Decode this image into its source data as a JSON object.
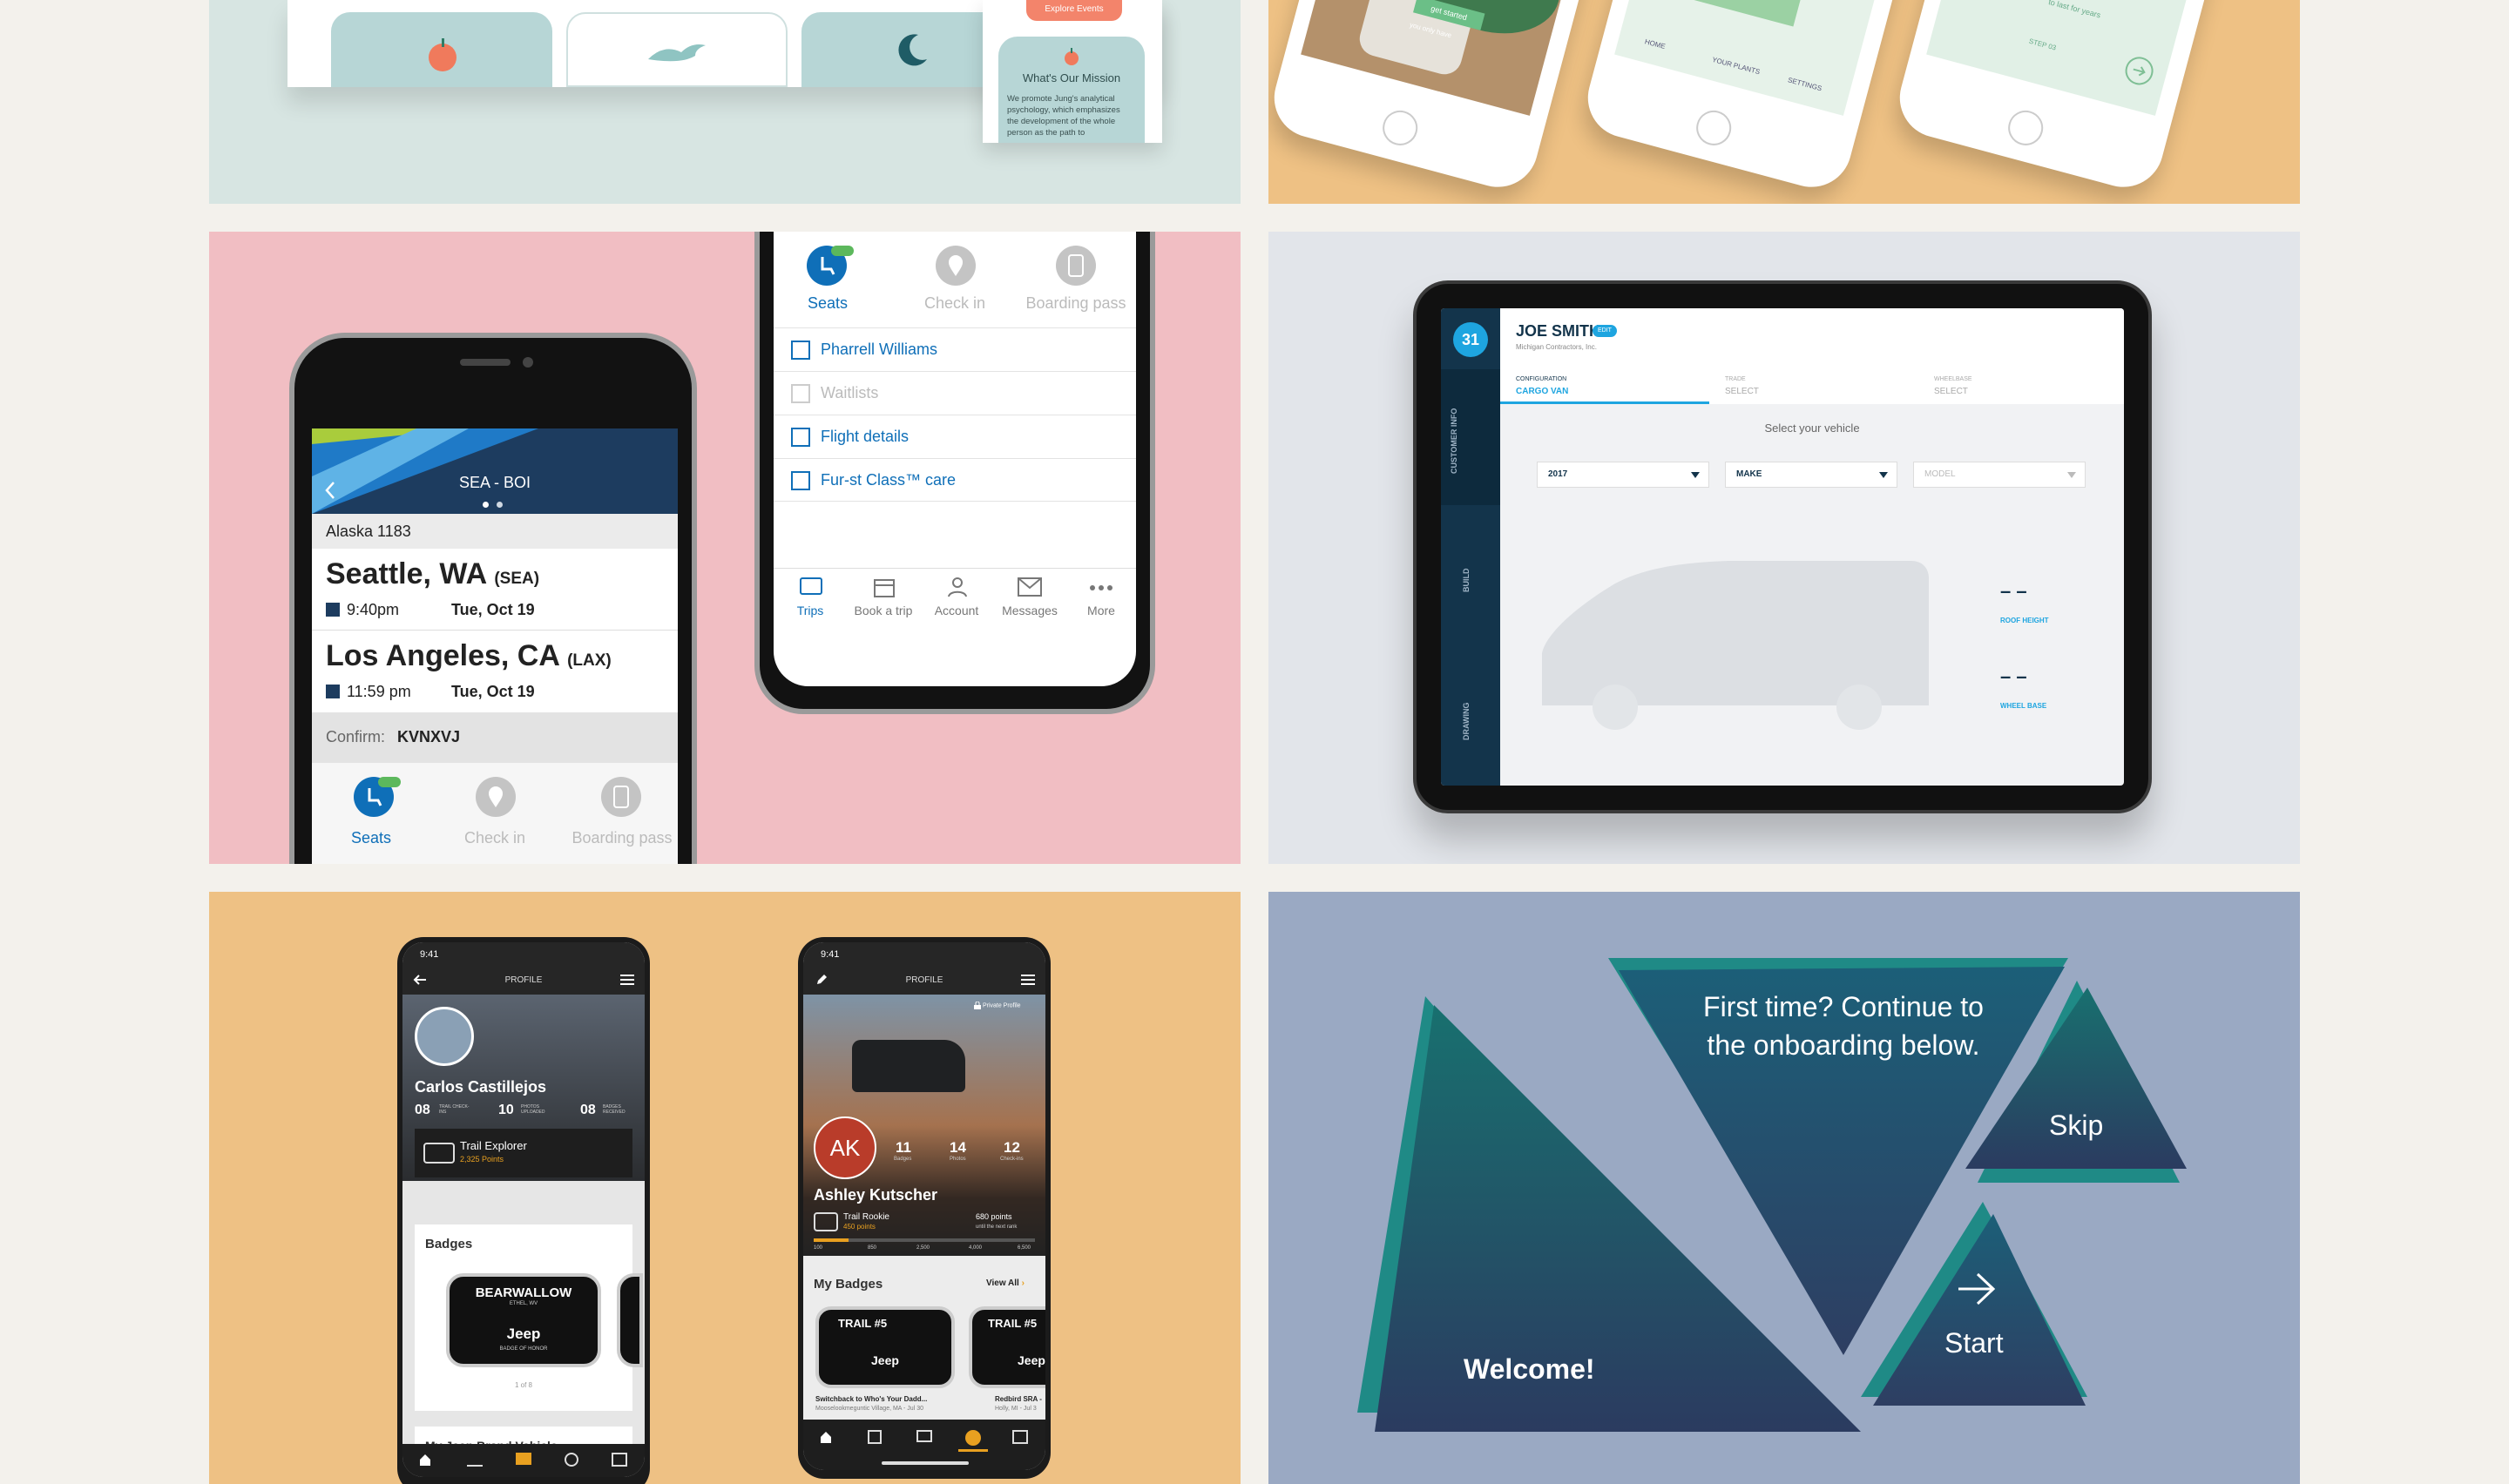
{
  "tiles": {
    "top_left": {
      "card_button": "Explore Events",
      "mission_title": "What's Our Mission",
      "mission_text": [
        "We promote Jung's analytical",
        "psychology, which emphasizes",
        "the development of the whole",
        "person as the path to"
      ]
    },
    "top_right": {
      "phone1_tag": "get started",
      "phone1_text": "you only have",
      "phone2_tabs": [
        "HOME",
        "YOUR PLANTS",
        "SETTINGS"
      ],
      "phone3_text": "to last for years",
      "phone3_step": "STEP 03"
    },
    "alaska": {
      "route": "SEA - BOI",
      "flight": "Alaska 1183",
      "departure": {
        "city": "Seattle, WA",
        "code": "(SEA)",
        "time": "9:40pm",
        "date": "Tue, Oct 19"
      },
      "arrival": {
        "city": "Los Angeles, CA",
        "code": "(LAX)",
        "time": "11:59 pm",
        "date": "Tue, Oct 19"
      },
      "confirm_label": "Confirm:",
      "confirm_code": "KVNXVJ",
      "actions": [
        "Seats",
        "Check in",
        "Boarding pass"
      ],
      "menu_items": [
        "Pharrell Williams",
        "Waitlists",
        "Flight details",
        "Fur-st Class™ care"
      ],
      "tab_bar": [
        "Trips",
        "Book a trip",
        "Account",
        "Messages",
        "More"
      ]
    },
    "tablet": {
      "name": "JOE SMITH",
      "edit": "EDIT",
      "company": "Michigan Contractors, Inc.",
      "steps": [
        "CUSTOMER INFO",
        "BUILD",
        "DRAWING"
      ],
      "tabs": [
        {
          "label": "CONFIGURATION",
          "value": "CARGO VAN"
        },
        {
          "label": "TRADE",
          "value": "SELECT"
        },
        {
          "label": "WHEELBASE",
          "value": "SELECT"
        }
      ],
      "prompt": "Select your vehicle",
      "dropdowns": [
        "2017",
        "MAKE",
        "MODEL"
      ],
      "metrics": [
        {
          "value": "– –",
          "label": "ROOF HEIGHT"
        },
        {
          "value": "– –",
          "label": "WHEEL BASE"
        }
      ]
    },
    "jeep_left": {
      "time": "9:41",
      "title": "PROFILE",
      "name": "Carlos Castillejos",
      "stats": [
        {
          "value": "08",
          "label": "TRAIL CHECK-INS"
        },
        {
          "value": "10",
          "label": "PHOTOS UPLOADED"
        },
        {
          "value": "08",
          "label": "BADGES RECEIVED"
        }
      ],
      "rank": "Trail Explorer",
      "points": "2,325 Points",
      "badges_title": "Badges",
      "badge_name": "BEARWALLOW",
      "badge_sub": "ETHEL, WV",
      "badge_brand": "Jeep",
      "badge_honor": "BADGE OF HONOR",
      "pager": "1 of 8",
      "next_section": "My Jeep Brand Vehicle"
    },
    "jeep_right": {
      "time": "9:41",
      "title": "PROFILE",
      "private": "Private Profile",
      "initials": "AK",
      "stats": [
        {
          "value": "11",
          "label": "Badges"
        },
        {
          "value": "14",
          "label": "Photos"
        },
        {
          "value": "12",
          "label": "Check-ins"
        }
      ],
      "name": "Ashley Kutscher",
      "rank": "Trail Rookie",
      "points": "450 points",
      "next": "680 points",
      "next_sub": "until the next rank",
      "scale": [
        "100",
        "850",
        "2,500",
        "4,000",
        "6,500"
      ],
      "badges_title": "My Badges",
      "view_all": "View All",
      "badge_label": "TRAIL #5",
      "badge_brand": "Jeep",
      "badges": [
        {
          "title": "Switchback to Who's Your Dadd...",
          "sub": "Mooselookmeguntic Village, MA - Jul 30"
        },
        {
          "title": "Redbird SRA -",
          "sub": "Holly, MI - Jul 3"
        }
      ]
    },
    "onboarding": {
      "headline_line1": "First time? Continue to",
      "headline_line2": "the onboarding below.",
      "welcome": "Welcome!",
      "skip": "Skip",
      "start": "Start"
    }
  },
  "colors": {
    "mint_bg": "#d7e5e2",
    "orange_bg": "#eec184",
    "pink_bg": "#f1bec3",
    "gray_bg": "#e2e5ea",
    "blue_gray_bg": "#9aa9c3",
    "alaska_navy": "#1d3c5f",
    "alaska_blue": "#0f6fb8",
    "tablet_navy": "#13344b",
    "tablet_accent": "#1ea5e0",
    "jeep_orange": "#e8a020",
    "jeep_red": "#b93c2a",
    "onboard_teal": "#1a6e7a"
  },
  "icons": [
    "apple-icon",
    "bird-icon",
    "moon-icon",
    "seat-icon",
    "location-pin-icon",
    "phone-pass-icon",
    "user-icon",
    "calendar-icon",
    "envelope-icon",
    "more-icon",
    "arrow-right-icon",
    "chevron-down-icon",
    "hamburger-icon",
    "back-arrow-icon",
    "lock-icon",
    "home-icon",
    "pencil-icon"
  ]
}
